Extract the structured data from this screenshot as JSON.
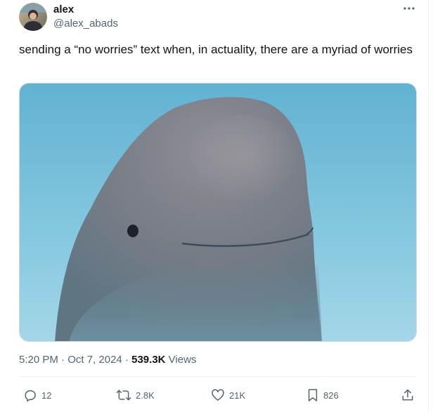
{
  "author": {
    "display_name": "alex",
    "handle": "@alex_abads",
    "avatar_icon": "profile-photo"
  },
  "more_icon": "more-horizontal-icon",
  "tweet": {
    "text": "sending a “no worries” text when, in actuality, there are a myriad of worries",
    "media_description": "close-up photo of a beluga whale with a faint smile against blue water"
  },
  "meta": {
    "time": "5:20 PM",
    "separator_1": " · ",
    "date": "Oct 7, 2024",
    "separator_2": " · ",
    "views_count": "539.3K",
    "views_label": " Views"
  },
  "actions": {
    "replies": "12",
    "reposts": "2.8K",
    "likes": "21K",
    "bookmarks": "826"
  },
  "colors": {
    "text": "#0f1419",
    "secondary": "#536471",
    "divider": "#eff3f4",
    "water": "#7ec3de",
    "whale": "#7a848c"
  }
}
